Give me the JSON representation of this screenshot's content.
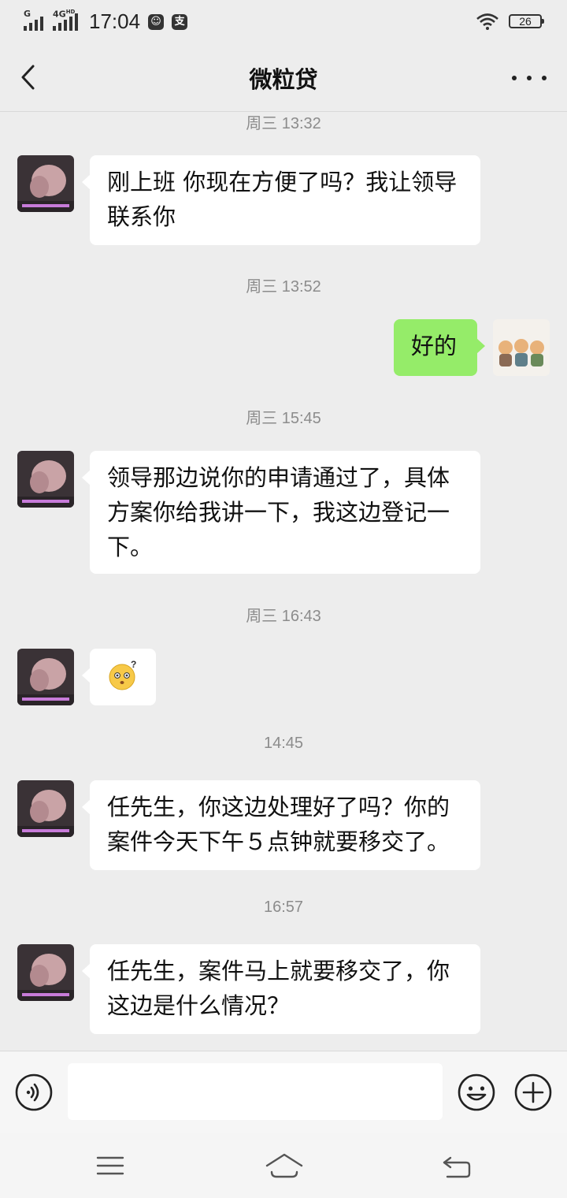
{
  "status_bar": {
    "network_1": "G",
    "network_2": "4G",
    "network_hd": "HD",
    "time": "17:04",
    "battery": "26",
    "icons": [
      "signal-icon",
      "signal-icon",
      "app-notification-icon",
      "alipay-icon",
      "wifi-icon",
      "battery-icon"
    ]
  },
  "header": {
    "title": "微粒贷",
    "back_icon": "chevron-left-icon",
    "more_icon": "more-dots-icon"
  },
  "messages": [
    {
      "type": "time",
      "text": "周三 13:32"
    },
    {
      "type": "msg",
      "side": "left",
      "text": "刚上班 你现在方便了吗？我让领导联系你"
    },
    {
      "type": "time",
      "text": "周三 13:52"
    },
    {
      "type": "msg",
      "side": "right",
      "text": "好的"
    },
    {
      "type": "time",
      "text": "周三 15:45"
    },
    {
      "type": "msg",
      "side": "left",
      "text": "领导那边说你的申请通过了，具体方案你给我讲一下，我这边登记一下。"
    },
    {
      "type": "time",
      "text": "周三 16:43"
    },
    {
      "type": "msg",
      "side": "left",
      "emoji": "confused-face-emoji"
    },
    {
      "type": "time",
      "text": "14:45"
    },
    {
      "type": "msg",
      "side": "left",
      "text": "任先生，你这边处理好了吗？你的案件今天下午５点钟就要移交了。"
    },
    {
      "type": "time",
      "text": "16:57"
    },
    {
      "type": "msg",
      "side": "left",
      "text": "任先生，案件马上就要移交了，你这边是什么情况？"
    }
  ],
  "input_bar": {
    "voice_icon": "voice-icon",
    "text_value": "",
    "emoji_icon": "emoji-icon",
    "plus_icon": "plus-circle-icon"
  },
  "system_nav": {
    "menu_icon": "menu-icon",
    "home_icon": "home-icon",
    "back_icon": "back-arrow-icon"
  },
  "colors": {
    "background": "#ededed",
    "bubble_incoming": "#ffffff",
    "bubble_outgoing": "#95ec69",
    "timestamp": "#8c8c8c"
  }
}
